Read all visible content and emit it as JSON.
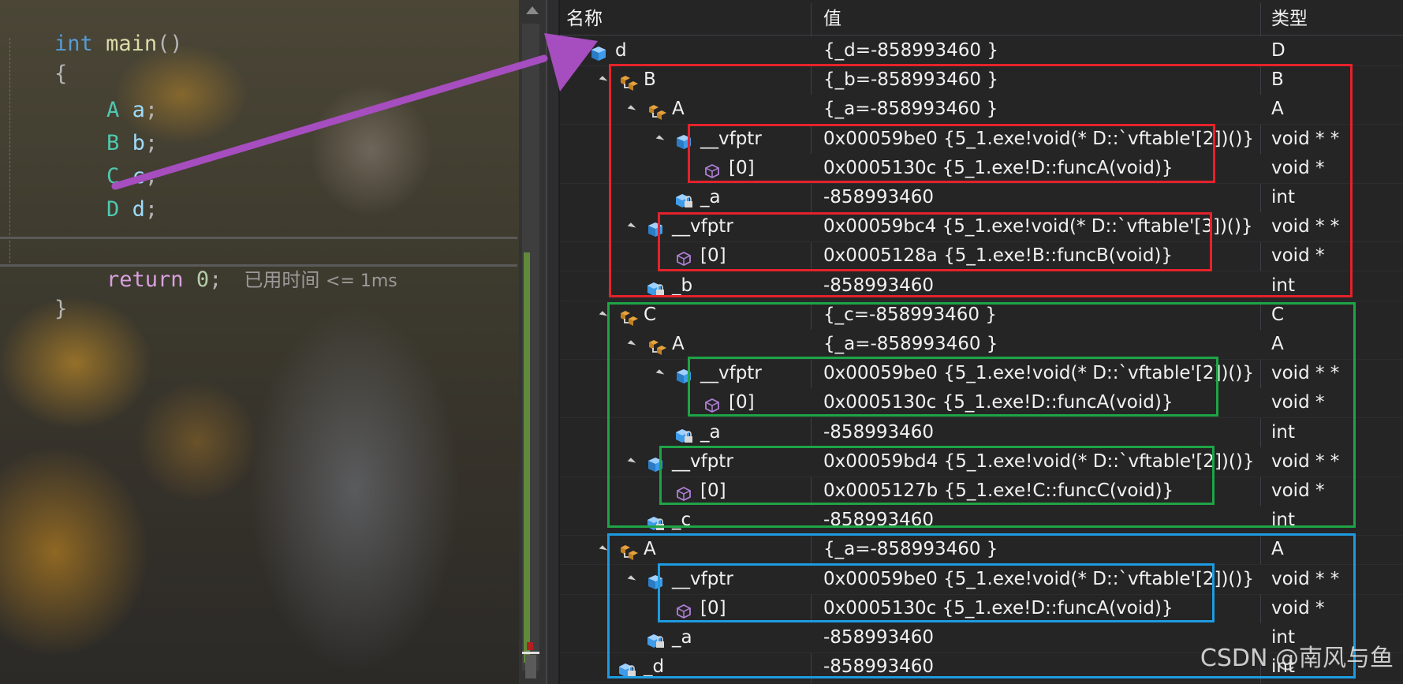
{
  "editor": {
    "lines": {
      "l1_kw": "int",
      "l1_fn": "main",
      "l1_paren": "()",
      "open_brace": "{",
      "l3_ty": "A",
      "l3_id": "a",
      "l3_semi": ";",
      "l4_ty": "B",
      "l4_id": "b",
      "l4_semi": ";",
      "l5_ty": "C",
      "l5_id": "c",
      "l5_semi": ";",
      "l6_ty": "D",
      "l6_id": "d",
      "l6_semi": ";",
      "ret_kw": "return",
      "ret_num": "0",
      "ret_semi": ";",
      "close_brace": "}"
    },
    "perf_tip": "已用时间",
    "perf_value": "<= 1ms"
  },
  "watch": {
    "columns": {
      "name": "名称",
      "value": "值",
      "type": "类型"
    },
    "rows": [
      {
        "name": "d",
        "value": "{_d=-858993460 }",
        "type": "D"
      },
      {
        "name": "B",
        "value": "{_b=-858993460 }",
        "type": "B"
      },
      {
        "name": "A",
        "value": "{_a=-858993460 }",
        "type": "A"
      },
      {
        "name": "__vfptr",
        "value": "0x00059be0 {5_1.exe!void(* D::`vftable'[2])()}",
        "extra": "{0x...",
        "type": "void * *"
      },
      {
        "name": "[0]",
        "value": "0x0005130c {5_1.exe!D::funcA(void)}",
        "type": "void *"
      },
      {
        "name": "_a",
        "value": "-858993460",
        "type": "int"
      },
      {
        "name": "__vfptr",
        "value": "0x00059bc4 {5_1.exe!void(* D::`vftable'[3])()}",
        "extra": "{0x...",
        "type": "void * *"
      },
      {
        "name": "[0]",
        "value": "0x0005128a {5_1.exe!B::funcB(void)}",
        "type": "void *"
      },
      {
        "name": "_b",
        "value": "-858993460",
        "type": "int"
      },
      {
        "name": "C",
        "value": "{_c=-858993460 }",
        "type": "C"
      },
      {
        "name": "A",
        "value": "{_a=-858993460 }",
        "type": "A"
      },
      {
        "name": "__vfptr",
        "value": "0x00059be0 {5_1.exe!void(* D::`vftable'[2])()}",
        "extra": "{0x...",
        "type": "void * *"
      },
      {
        "name": "[0]",
        "value": "0x0005130c {5_1.exe!D::funcA(void)}",
        "type": "void *"
      },
      {
        "name": "_a",
        "value": "-858993460",
        "type": "int"
      },
      {
        "name": "__vfptr",
        "value": "0x00059bd4 {5_1.exe!void(* D::`vftable'[2])()}",
        "extra": "{0x...",
        "type": "void * *"
      },
      {
        "name": "[0]",
        "value": "0x0005127b {5_1.exe!C::funcC(void)}",
        "type": "void *"
      },
      {
        "name": "_c",
        "value": "-858993460",
        "type": "int"
      },
      {
        "name": "A",
        "value": "{_a=-858993460 }",
        "type": "A"
      },
      {
        "name": "__vfptr",
        "value": "0x00059be0 {5_1.exe!void(* D::`vftable'[2])()}",
        "extra": "{0x...",
        "type": "void * *"
      },
      {
        "name": "[0]",
        "value": "0x0005130c {5_1.exe!D::funcA(void)}",
        "type": "void *"
      },
      {
        "name": "_a",
        "value": "-858993460",
        "type": "int"
      },
      {
        "name": "_d",
        "value": "-858993460",
        "type": "int"
      }
    ]
  },
  "watermark": "CSDN @南风与鱼",
  "colors": {
    "arrow": "#a64dbf",
    "box_red": "#e5222b",
    "box_green": "#1ea446",
    "box_blue": "#1e9be0"
  }
}
